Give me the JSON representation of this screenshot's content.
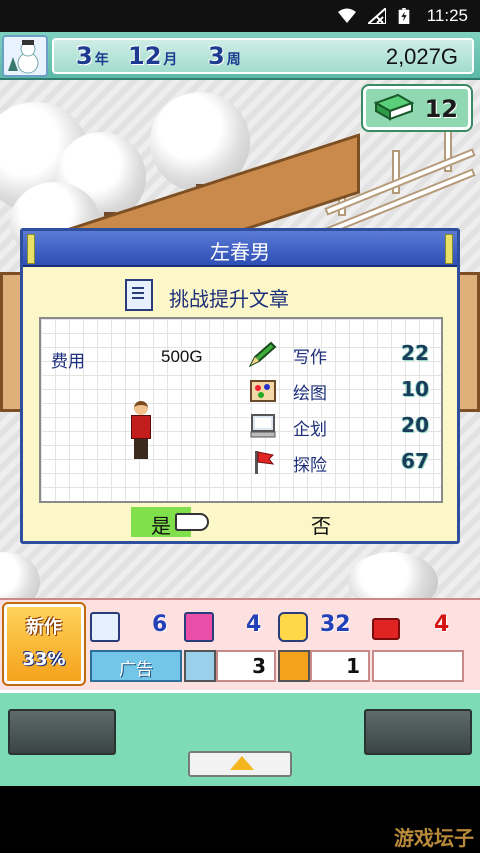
{
  "status_bar": {
    "time": "11:25",
    "icons": [
      "wifi-icon",
      "no-signal-icon",
      "battery-icon"
    ]
  },
  "hud": {
    "date": {
      "year": "3",
      "year_unit": "年",
      "month": "12",
      "month_unit": "月",
      "week": "3",
      "week_unit": "周"
    },
    "money": "2,027G",
    "research_points": "12"
  },
  "dialog": {
    "title": "左春男",
    "heading": "挑战提升文章",
    "cost_label": "费用",
    "cost_value": "500G",
    "stats": [
      {
        "label": "写作",
        "value": "22",
        "icon": "pencil-icon"
      },
      {
        "label": "绘图",
        "value": "10",
        "icon": "palette-icon"
      },
      {
        "label": "企划",
        "value": "20",
        "icon": "computer-icon"
      },
      {
        "label": "探险",
        "value": "67",
        "icon": "flag-icon"
      }
    ],
    "yes_label": "是",
    "no_label": "否"
  },
  "bottom_hud": {
    "new_title": "新作",
    "new_progress": "33%",
    "count_doc": "6",
    "count_monitor": "4",
    "count_smile": "32",
    "count_red": "4",
    "ad_label": "广告",
    "slot1_value": "3",
    "slot2_value": "1"
  },
  "watermark": "游戏坛子",
  "colors": {
    "dialog_title_bg": "#2e4fb5",
    "dialog_bg": "#fbf7c9",
    "yes_highlight": "#7fe04b",
    "bottom_bar": "#7ddcb6"
  }
}
